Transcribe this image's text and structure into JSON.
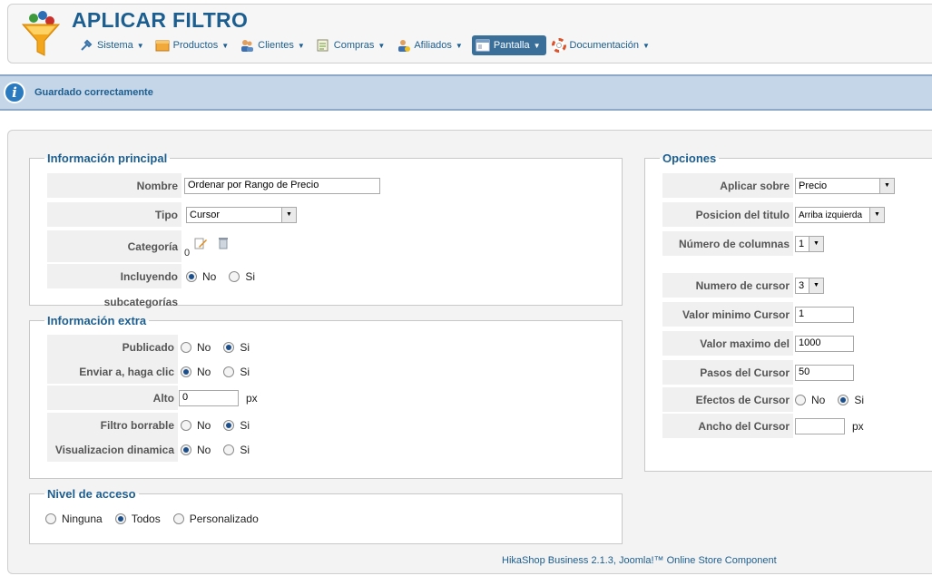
{
  "header": {
    "title": "APLICAR FILTRO",
    "menu": [
      {
        "label": "Sistema",
        "icon": "wrench-icon"
      },
      {
        "label": "Productos",
        "icon": "box-icon"
      },
      {
        "label": "Clientes",
        "icon": "users-icon"
      },
      {
        "label": "Compras",
        "icon": "cart-icon"
      },
      {
        "label": "Afiliados",
        "icon": "affiliate-icon"
      },
      {
        "label": "Pantalla",
        "icon": "display-icon",
        "active": true
      },
      {
        "label": "Documentación",
        "icon": "lifebuoy-icon"
      }
    ]
  },
  "message": {
    "text": "Guardado correctamente"
  },
  "main_info": {
    "legend": "Información principal",
    "nombre_label": "Nombre",
    "nombre_value": "Ordenar por Rango de Precio",
    "tipo_label": "Tipo",
    "tipo_value": "Cursor",
    "categoria_label": "Categoría",
    "categoria_value": "0",
    "subcat_label": "Incluyendo subcategorías",
    "subcat_no": "No",
    "subcat_si": "Si"
  },
  "extra_info": {
    "legend": "Información extra",
    "publicado_label": "Publicado",
    "enviar_label": "Enviar a, haga clic",
    "alto_label": "Alto",
    "alto_value": "0",
    "alto_unit": "px",
    "borrable_label": "Filtro borrable",
    "dinamica_label": "Visualizacion dinamica",
    "no": "No",
    "si": "Si"
  },
  "access": {
    "legend": "Nivel de acceso",
    "ninguna": "Ninguna",
    "todos": "Todos",
    "personalizado": "Personalizado"
  },
  "options": {
    "legend": "Opciones",
    "aplicar_label": "Aplicar sobre",
    "aplicar_value": "Precio",
    "posicion_label": "Posicion del titulo",
    "posicion_value": "Arriba izquierda",
    "columnas_label": "Número de columnas",
    "columnas_value": "1",
    "cursor_num_label": "Numero de cursor",
    "cursor_num_value": "3",
    "min_label": "Valor minimo Cursor",
    "min_value": "1",
    "max_label": "Valor maximo del Cursor",
    "max_value": "1000",
    "pasos_label": "Pasos del Cursor",
    "pasos_value": "50",
    "efectos_label": "Efectos de Cursor",
    "no": "No",
    "si": "Si",
    "ancho_label": "Ancho del Cursor",
    "ancho_value": "",
    "ancho_unit": "px"
  },
  "footer": {
    "text": "HikaShop Business 2.1.3, Joomla!™ Online Store Component"
  }
}
